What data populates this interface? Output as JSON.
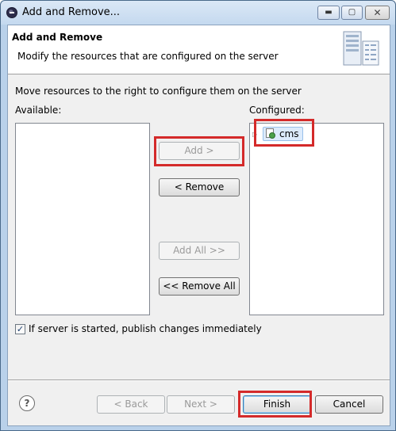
{
  "window": {
    "title": "Add and Remove...",
    "minimize": "▬",
    "maximize": "▢",
    "close": "✕"
  },
  "header": {
    "title": "Add and Remove",
    "description": "Modify the resources that are configured on the server"
  },
  "body": {
    "instruction": "Move resources to the right to configure them on the server",
    "available_label": "Available:",
    "configured_label": "Configured:",
    "configured_items": [
      {
        "label": "cms",
        "icon": "web-project-icon"
      }
    ],
    "expander": "▷"
  },
  "buttons": {
    "add": "Add >",
    "remove": "< Remove",
    "add_all": "Add All >>",
    "remove_all": "<< Remove All",
    "back": "< Back",
    "next": "Next >",
    "finish": "Finish",
    "cancel": "Cancel"
  },
  "options": {
    "publish_label": "If server is started, publish changes immediately",
    "publish_checked": true,
    "check_mark": "✓"
  },
  "help": "?"
}
